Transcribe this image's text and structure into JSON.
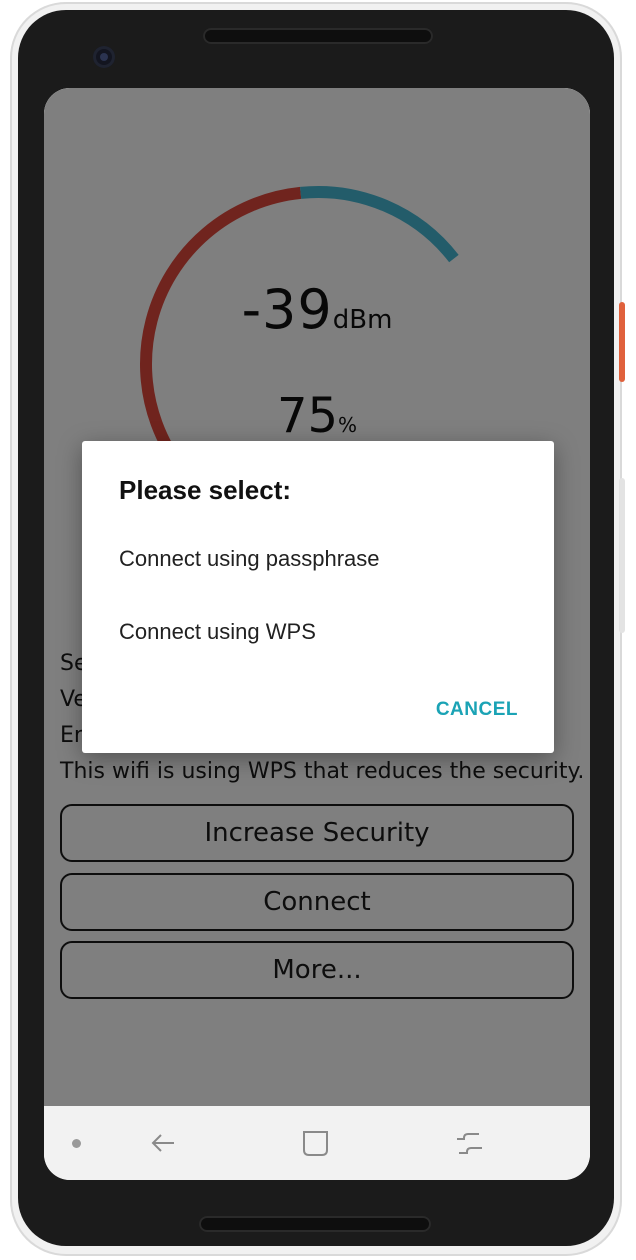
{
  "gauge": {
    "dbm_value": "-39",
    "dbm_unit": "dBm",
    "percent_value": "75",
    "percent_unit": "%",
    "signal_fraction": 0.75,
    "colors": {
      "strong": "#8b2b22",
      "weak": "#2d7f93"
    }
  },
  "info_lines": [
    "Se",
    "Ve",
    "En",
    "This wifi is using WPS that reduces the security."
  ],
  "buttons": {
    "increase_security": "Increase Security",
    "connect": "Connect",
    "more": "More..."
  },
  "dialog": {
    "title": "Please select:",
    "option_passphrase": "Connect using passphrase",
    "option_wps": "Connect using WPS",
    "cancel": "CANCEL"
  },
  "navbar": {
    "icons": [
      "dot-indicator-icon",
      "back-icon",
      "home-square-icon",
      "recents-icon"
    ]
  }
}
